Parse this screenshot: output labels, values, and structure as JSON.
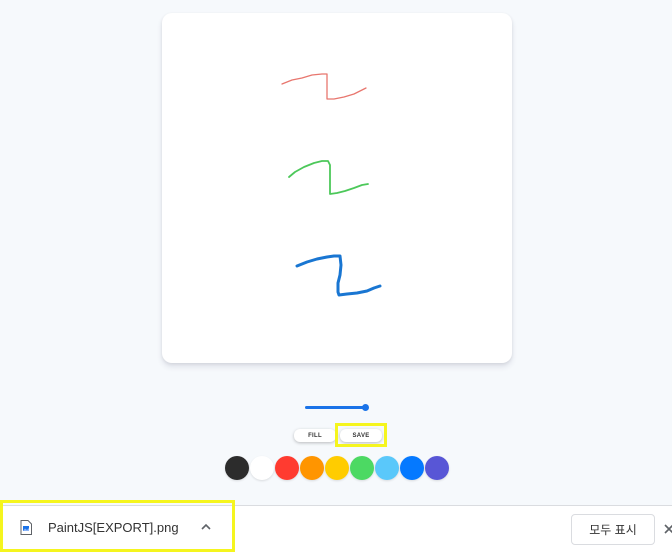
{
  "canvas": {
    "background": "#ffffff"
  },
  "strokes": [
    {
      "color": "#e8766e"
    },
    {
      "color": "#4cc85a"
    },
    {
      "color": "#1976d2"
    }
  ],
  "brush": {
    "level": 1.0
  },
  "controls": {
    "fill_label": "FILL",
    "save_label": "SAVE"
  },
  "palette": [
    {
      "name": "black",
      "hex": "#2c2c2c"
    },
    {
      "name": "white",
      "hex": "#ffffff"
    },
    {
      "name": "red",
      "hex": "#ff3b30"
    },
    {
      "name": "orange",
      "hex": "#ff9500"
    },
    {
      "name": "yellow",
      "hex": "#ffcc00"
    },
    {
      "name": "green",
      "hex": "#4cd963"
    },
    {
      "name": "light-blue",
      "hex": "#5ac8fa"
    },
    {
      "name": "blue",
      "hex": "#0579ff"
    },
    {
      "name": "purple",
      "hex": "#5856d6"
    }
  ],
  "download_bar": {
    "file_name": "PaintJS[EXPORT].png",
    "file_icon": "image-file-icon",
    "show_all_label": "모두 표시",
    "close_icon": "close-icon"
  },
  "highlight_color": "#f5f51e"
}
